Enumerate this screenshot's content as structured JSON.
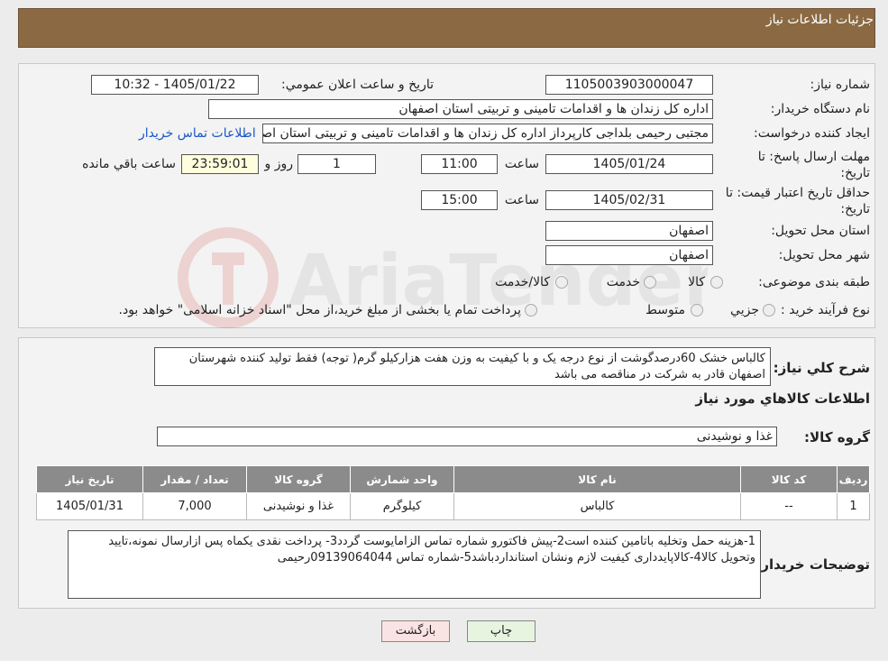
{
  "header": {
    "title": "جزئیات اطلاعات نیاز"
  },
  "fields": {
    "need_number_label": "شماره نیاز:",
    "need_number": "1105003903000047",
    "announce_label": "تاریخ و ساعت اعلان عمومي:",
    "announce_value": "1405/01/22 - 10:32",
    "buyer_label": "نام دستگاه خریدار:",
    "buyer_value": "اداره کل زندان ها و اقدامات تامینی و تربیتی استان اصفهان",
    "creator_label": "ایجاد کننده درخواست:",
    "creator_value": "مجتبی رحیمی بلداجی کارپرداز اداره کل زندان ها و اقدامات تامینی و تربیتی استان اصفهان",
    "contact_link": "اطلاعات تماس خریدار",
    "deadline_label_1": "مهلت ارسال پاسخ: تا",
    "deadline_label_2": "تاریخ:",
    "deadline_date": "1405/01/24",
    "time_label": "ساعت",
    "deadline_time": "11:00",
    "days_value": "1",
    "days_label": "روز و",
    "remaining_time": "23:59:01",
    "remaining_label": "ساعت باقي مانده",
    "validity_label_1": "حداقل تاریخ اعتبار قیمت: تا",
    "validity_label_2": "تاریخ:",
    "validity_date": "1405/02/31",
    "validity_time": "15:00",
    "province_label": "استان محل تحویل:",
    "province_value": "اصفهان",
    "city_label": "شهر محل تحویل:",
    "city_value": "اصفهان",
    "category_label": "طبقه بندی موضوعی:",
    "category_options": [
      "کالا",
      "خدمت",
      "کالا/خدمت"
    ],
    "process_label": "نوع فرآیند خرید :",
    "process_options": [
      "جزیي",
      "متوسط"
    ],
    "process_note": "پرداخت تمام یا بخشی از مبلغ خرید،از محل \"اسناد خزانه اسلامی\" خواهد بود."
  },
  "details": {
    "summary_label": "شرح کلي نیاز:",
    "summary_text": "کالباس خشک  60درصدگوشت از نوع درجه یک و با کیفیت    به وزن هفت هزارکیلو گرم( توجه) فقط تولید کننده شهرستان  اصفهان  قادر به شرکت در مناقصه می باشد",
    "goods_info_title": "اطلاعات کالاهاي مورد نیاز",
    "goods_group_label": "گروه کالا:",
    "goods_group_value": "غذا و نوشیدنی"
  },
  "table": {
    "headers": [
      "ردیف",
      "کد کالا",
      "نام کالا",
      "واحد شمارش",
      "گروه کالا",
      "تعداد / مقدار",
      "تاریخ نیاز"
    ],
    "rows": [
      [
        "1",
        "--",
        "کالباس",
        "کیلوگرم",
        "غذا و نوشیدنی",
        "7,000",
        "1405/01/31"
      ]
    ]
  },
  "buyer_notes": {
    "label": "توضیحات خریدار:",
    "text": "1-هزینه حمل وتخلیه باتامین کننده است2-پیش فاکتورو شماره تماس الزامایوست گردد3- پرداخت نقدی یکماه  پس ازارسال نمونه،تایید وتحویل کالا4-کالاپایدداری کیفیت لازم ونشان استانداردباشد5-شماره تماس 09139064044رحیمی"
  },
  "buttons": {
    "print": "چاپ",
    "back": "بازگشت"
  },
  "colors": {
    "header_bg": "#8b6a43",
    "link": "#1a56c9",
    "back_button_bg": "#fbe3e3",
    "print_button_bg": "#e6f4e0"
  },
  "watermark": {
    "text": "AriaTender.neT"
  }
}
